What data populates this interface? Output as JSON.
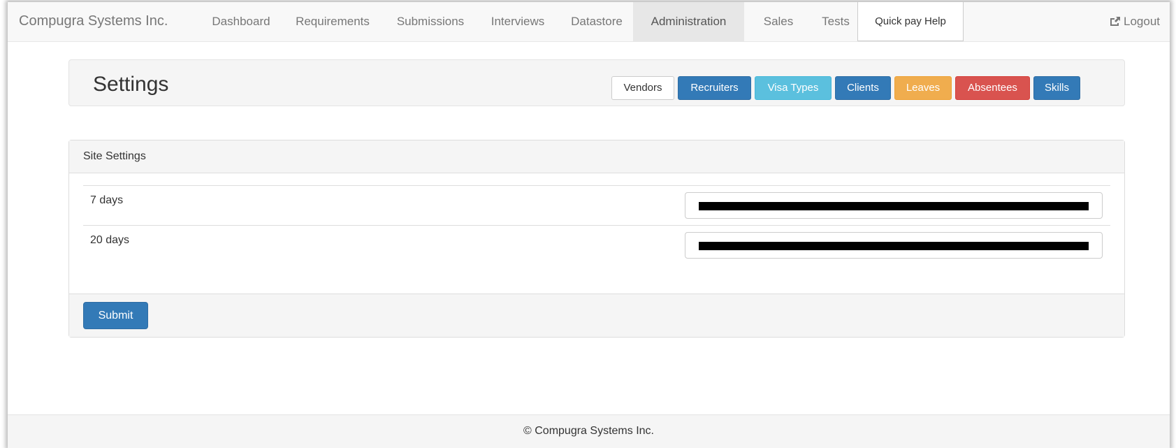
{
  "navbar": {
    "brand": "Compugra Systems Inc.",
    "items": [
      {
        "label": "Dashboard"
      },
      {
        "label": "Requirements"
      },
      {
        "label": "Submissions"
      },
      {
        "label": "Interviews"
      },
      {
        "label": "Datastore"
      },
      {
        "label": "Administration",
        "active": true
      },
      {
        "label": "Sales"
      },
      {
        "label": "Tests"
      },
      {
        "label": "Quick pay Help"
      }
    ],
    "logout_label": "Logout",
    "logout_icon": "share-square-icon"
  },
  "page_header": {
    "title": "Settings",
    "buttons": [
      {
        "label": "Vendors",
        "style": "default",
        "color": "#ffffff"
      },
      {
        "label": "Recruiters",
        "style": "primary",
        "color": "#337ab7"
      },
      {
        "label": "Visa Types",
        "style": "info",
        "color": "#5bc0de"
      },
      {
        "label": "Clients",
        "style": "primary",
        "color": "#337ab7"
      },
      {
        "label": "Leaves",
        "style": "warning",
        "color": "#f0ad4e"
      },
      {
        "label": "Absentees",
        "style": "danger",
        "color": "#d9534f"
      },
      {
        "label": "Skills",
        "style": "primary",
        "color": "#337ab7"
      }
    ]
  },
  "site_settings": {
    "heading": "Site Settings",
    "rows": [
      {
        "label": "7 days",
        "value_redacted": true
      },
      {
        "label": "20 days",
        "value_redacted": true
      }
    ],
    "submit_label": "Submit"
  },
  "footer": {
    "text": "© Compugra Systems Inc."
  }
}
